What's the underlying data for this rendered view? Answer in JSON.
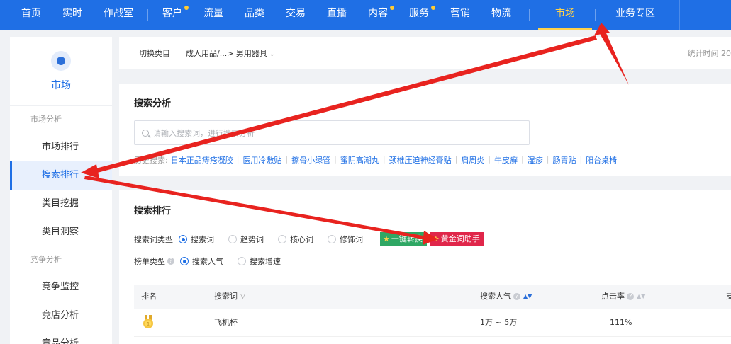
{
  "nav": {
    "items": [
      {
        "label": "首页",
        "dot": false
      },
      {
        "label": "实时",
        "dot": false
      },
      {
        "label": "作战室",
        "dot": false
      },
      {
        "label": "客户",
        "dot": true
      },
      {
        "label": "流量",
        "dot": false
      },
      {
        "label": "品类",
        "dot": false
      },
      {
        "label": "交易",
        "dot": false
      },
      {
        "label": "直播",
        "dot": false
      },
      {
        "label": "内容",
        "dot": true
      },
      {
        "label": "服务",
        "dot": true
      },
      {
        "label": "营销",
        "dot": false
      },
      {
        "label": "物流",
        "dot": false
      }
    ],
    "active": "市场",
    "business": "业务专区",
    "accent": "#1f6fe5",
    "highlight": "#ffd24a"
  },
  "sidebar": {
    "title": "市场",
    "groups": [
      {
        "label": "市场分析",
        "items": [
          "市场排行",
          "搜索排行",
          "类目挖掘",
          "类目洞察"
        ]
      },
      {
        "label": "竞争分析",
        "items": [
          "竞争监控",
          "竞店分析",
          "竞品分析"
        ]
      }
    ],
    "active_item": "搜索排行"
  },
  "crumb": {
    "switch": "切换类目",
    "path": "成人用品/...> 男用器具",
    "stat": "统计时间 20"
  },
  "search_analysis": {
    "title": "搜索分析",
    "placeholder": "请输入搜索词，进行搜索分析",
    "hot_label": "历史搜索:",
    "hot_terms": [
      "日本正品痔疮凝胶",
      "医用冷敷贴",
      "擦骨小绿管",
      "蜜阴高潮丸",
      "颈椎压迫神经膏贴",
      "肩周炎",
      "牛皮癣",
      "湿疹",
      "肠胃贴",
      "阳台桌椅"
    ]
  },
  "search_rank": {
    "title": "搜索排行",
    "type_label": "搜索词类型",
    "type_options": [
      "搜索词",
      "趋势词",
      "核心词",
      "修饰词"
    ],
    "type_selected": "搜索词",
    "btn_convert": "一键转换",
    "btn_golden": "黄金词助手",
    "list_label": "榜单类型",
    "list_options": [
      "搜索人气",
      "搜索增速"
    ],
    "list_selected": "搜索人气",
    "columns": [
      "排名",
      "搜索词",
      "搜索人气",
      "点击率",
      "支"
    ],
    "rows": [
      {
        "rank_icon": "gold-medal-icon",
        "keyword": "飞机杯",
        "popularity": "1万 ~ 5万",
        "ctr": "111%"
      }
    ]
  }
}
